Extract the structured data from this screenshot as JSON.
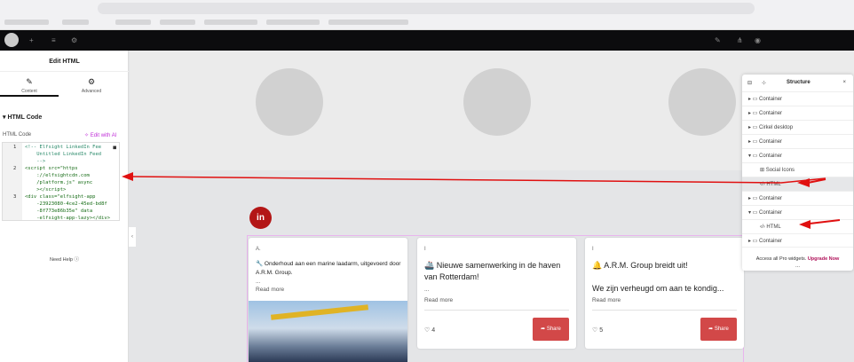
{
  "editor": {
    "panel_title": "Edit HTML",
    "tabs": [
      {
        "label": "Content",
        "icon": "pencil-icon"
      },
      {
        "label": "Advanced",
        "icon": "gear-icon"
      }
    ],
    "section": "HTML Code",
    "code_label": "HTML Code",
    "edit_ai": "Edit with AI",
    "code_lines": [
      {
        "n": "1",
        "text": "<!-- Elfsight LinkedIn Fee\n    Untitled LinkedIn Feed\n    -->"
      },
      {
        "n": "2",
        "text": "<script src=\"https\n    ://elfsightcdn.com\n    /platform.js\" async\n    ></script>"
      },
      {
        "n": "3",
        "text": "<div class=\"elfsight-app\n    -23923080-4ce2-45ed-bd8f\n    -8f773e86b35e\" data\n    -elfsight-app-lazy></div>"
      }
    ],
    "need_help": "Need Help"
  },
  "linkedin_icon": "in",
  "cards": [
    {
      "author": "A.",
      "text": "🔧 Onderhoud aan een marine laadarm, uitgevoerd door A.R.M. Group.",
      "ellipsis": "...",
      "read_more": "Read more"
    },
    {
      "author": "I",
      "text": "🚢 Nieuwe samenwerking in de haven van Rotterdam!",
      "ellipsis": "...",
      "read_more": "Read more",
      "likes": "4",
      "share": "Share"
    },
    {
      "author": "I",
      "text": "🔔 A.R.M. Group breidt uit!",
      "text2": "We zijn verheugd om aan te kondig...",
      "read_more": "Read more",
      "likes": "5",
      "share": "Share"
    }
  ],
  "structure": {
    "title": "Structure",
    "close": "×",
    "items": [
      {
        "label": "Container",
        "expanded": false
      },
      {
        "label": "Container",
        "expanded": false
      },
      {
        "label": "Cirkel desktop",
        "expanded": false
      },
      {
        "label": "Container",
        "expanded": false
      },
      {
        "label": "Container",
        "expanded": true
      },
      {
        "label": "Social Icons",
        "child": true
      },
      {
        "label": "HTML",
        "child": true,
        "selected": true
      },
      {
        "label": "Container",
        "expanded": false
      },
      {
        "label": "Container",
        "expanded": true
      },
      {
        "label": "HTML",
        "child": true
      },
      {
        "label": "Container",
        "expanded": false
      }
    ],
    "upgrade_text": "Access all Pro widgets.",
    "upgrade_link": "Upgrade Now",
    "more": "..."
  },
  "colors": {
    "accent": "#d24848",
    "linkedin": "#b31616",
    "arrow": "#e01010"
  }
}
